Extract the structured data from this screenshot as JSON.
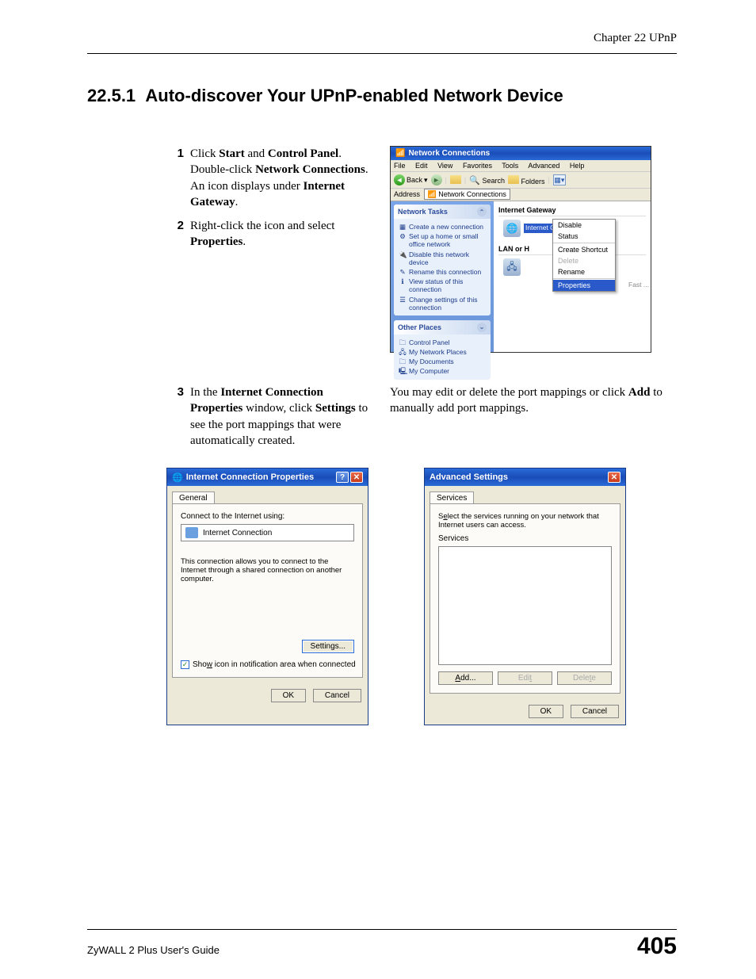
{
  "header": {
    "chapter": "Chapter 22 UPnP"
  },
  "section": {
    "number": "22.5.1",
    "title": "Auto-discover Your UPnP-enabled Network Device"
  },
  "step1": {
    "num": "1",
    "t1": "Click ",
    "b1": "Start",
    "t2": " and ",
    "b2": "Control Panel",
    "t3": ". Double-click ",
    "b3": "Network Connections",
    "t4": ". An icon displays under ",
    "b4": "Internet Gateway",
    "t5": "."
  },
  "step2": {
    "num": "2",
    "t1": "Right-click the icon and select ",
    "b1": "Properties",
    "t2": "."
  },
  "step3": {
    "num": "3",
    "t1": "In the ",
    "b1": "Internet Connection Properties",
    "t2": " window, click ",
    "b2": "Settings",
    "t3": " to see the port mappings that were automatically created."
  },
  "rightnote": {
    "t1": "You may edit or delete the port mappings or click ",
    "b1": "Add",
    "t2": " to manually add port mappings."
  },
  "fig1": {
    "title": "Network Connections",
    "menu": {
      "file": "File",
      "edit": "Edit",
      "view": "View",
      "fav": "Favorites",
      "tools": "Tools",
      "adv": "Advanced",
      "help": "Help"
    },
    "toolbar": {
      "back": "Back",
      "search": "Search",
      "folders": "Folders"
    },
    "address_label": "Address",
    "address_val": "Network Connections",
    "sidepanel1": {
      "title": "Network Tasks",
      "items": [
        "Create a new connection",
        "Set up a home or small office network",
        "Disable this network device",
        "Rename this connection",
        "View status of this connection",
        "Change settings of this connection"
      ]
    },
    "sidepanel2": {
      "title": "Other Places",
      "items": [
        "Control Panel",
        "My Network Places",
        "My Documents",
        "My Computer"
      ]
    },
    "group1": "Internet Gateway",
    "conn1": "Internet Connection",
    "group2": "LAN or H",
    "truncated": "Fast ...",
    "ctx": {
      "disable": "Disable",
      "status": "Status",
      "shortcut": "Create Shortcut",
      "delete": "Delete",
      "rename": "Rename",
      "props": "Properties"
    }
  },
  "fig2": {
    "title": "Internet Connection Properties",
    "tab": "General",
    "label1": "Connect to the Internet using:",
    "conn": "Internet Connection",
    "desc": "This connection allows you to connect to the Internet through a shared connection on another computer.",
    "settings": "Settings...",
    "chk_pre": "Sho",
    "chk_u": "w",
    "chk_post": " icon in notification area when connected",
    "ok": "OK",
    "cancel": "Cancel"
  },
  "fig3": {
    "title": "Advanced Settings",
    "tab": "Services",
    "desc_pre": "S",
    "desc_u": "e",
    "desc_post": "lect the services running on your network that Internet users can access.",
    "label": "Services",
    "add_u": "A",
    "add_post": "dd...",
    "edit_pre": "Edi",
    "edit_u": "t",
    "del_pre": "Dele",
    "del_u": "t",
    "del_post": "e",
    "ok": "OK",
    "cancel": "Cancel"
  },
  "footer": {
    "guide": "ZyWALL 2 Plus User's Guide",
    "page": "405"
  }
}
